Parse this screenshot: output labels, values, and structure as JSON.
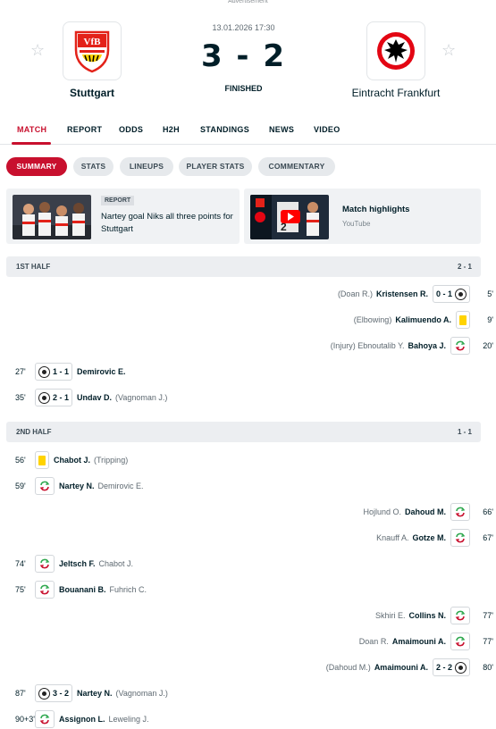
{
  "ad_label": "Advertisement",
  "match": {
    "datetime": "13.01.2026 17:30",
    "score": "3 - 2",
    "status": "FINISHED",
    "home_team": "Stuttgart",
    "away_team": "Eintracht Frankfurt"
  },
  "tabs": [
    "MATCH",
    "REPORT",
    "ODDS",
    "H2H",
    "STANDINGS",
    "NEWS",
    "VIDEO"
  ],
  "subtabs": [
    "SUMMARY",
    "STATS",
    "LINEUPS",
    "PLAYER STATS",
    "COMMENTARY"
  ],
  "cards": {
    "report_badge": "REPORT",
    "report_title": "Nartey goal Niks all three points for Stuttgart",
    "video_title": "Match highlights",
    "video_source": "YouTube"
  },
  "colors": {
    "accent": "#c8102e",
    "yellow_card": "#ffd300",
    "sub_in": "#2fa84f",
    "sub_out": "#c8102e"
  },
  "first_half": {
    "label": "1ST HALF",
    "score": "2 - 1",
    "events": [
      {
        "side": "away",
        "minute": "5'",
        "type": "goal",
        "score": "0 - 1",
        "player": "Kristensen R.",
        "extra": "(Doan R.)"
      },
      {
        "side": "away",
        "minute": "9'",
        "type": "yellow-card",
        "player": "Kalimuendo A.",
        "extra": "(Elbowing)"
      },
      {
        "side": "away",
        "minute": "20'",
        "type": "substitution",
        "player": "Bahoya J.",
        "extra": "(Injury) Ebnoutalib Y."
      },
      {
        "side": "home",
        "minute": "27'",
        "type": "goal",
        "score": "1 - 1",
        "player": "Demirovic E.",
        "extra": ""
      },
      {
        "side": "home",
        "minute": "35'",
        "type": "goal",
        "score": "2 - 1",
        "player": "Undav D.",
        "extra": "(Vagnoman J.)"
      }
    ]
  },
  "second_half": {
    "label": "2ND HALF",
    "score": "1 - 1",
    "events": [
      {
        "side": "home",
        "minute": "56'",
        "type": "yellow-card",
        "player": "Chabot J.",
        "extra": "(Tripping)"
      },
      {
        "side": "home",
        "minute": "59'",
        "type": "substitution",
        "player": "Nartey N.",
        "extra": "Demirovic E."
      },
      {
        "side": "away",
        "minute": "66'",
        "type": "substitution",
        "player": "Dahoud M.",
        "extra": "Hojlund O."
      },
      {
        "side": "away",
        "minute": "67'",
        "type": "substitution",
        "player": "Gotze M.",
        "extra": "Knauff A."
      },
      {
        "side": "home",
        "minute": "74'",
        "type": "substitution",
        "player": "Jeltsch F.",
        "extra": "Chabot J."
      },
      {
        "side": "home",
        "minute": "75'",
        "type": "substitution",
        "player": "Bouanani B.",
        "extra": "Fuhrich C."
      },
      {
        "side": "away",
        "minute": "77'",
        "type": "substitution",
        "player": "Collins N.",
        "extra": "Skhiri E."
      },
      {
        "side": "away",
        "minute": "77'",
        "type": "substitution",
        "player": "Amaimouni A.",
        "extra": "Doan R."
      },
      {
        "side": "away",
        "minute": "80'",
        "type": "goal",
        "score": "2 - 2",
        "player": "Amaimouni A.",
        "extra": "(Dahoud M.)"
      },
      {
        "side": "home",
        "minute": "87'",
        "type": "goal",
        "score": "3 - 2",
        "player": "Nartey N.",
        "extra": "(Vagnoman J.)"
      },
      {
        "side": "home",
        "minute": "90+3'",
        "type": "substitution",
        "player": "Assignon L.",
        "extra": "Leweling J."
      }
    ]
  }
}
